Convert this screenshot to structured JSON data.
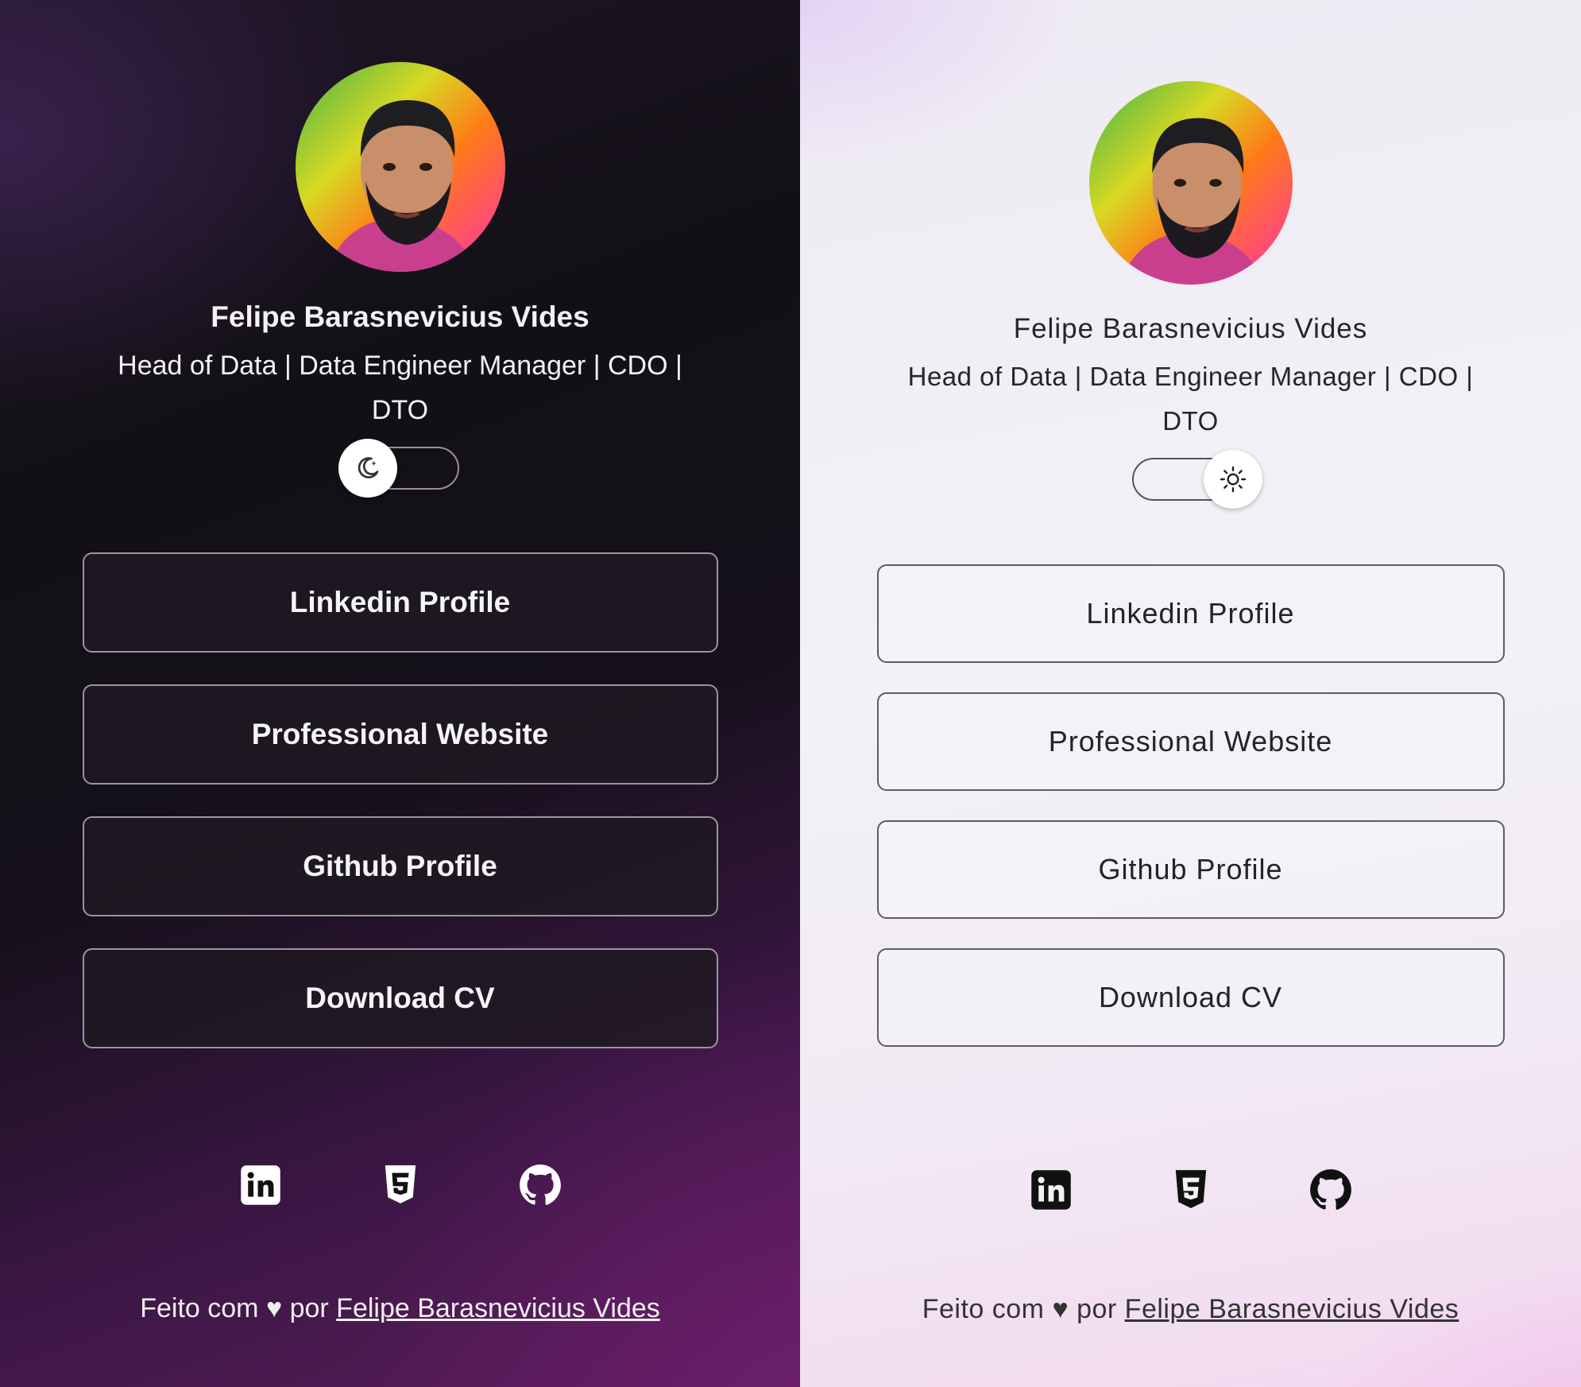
{
  "profile": {
    "name": "Felipe Barasnevicius Vides",
    "bio_line1": "Head of Data | Data Engineer Manager | CDO |",
    "bio_line2": "DTO",
    "avatar_alt": "avatar"
  },
  "theme_toggle": {
    "dark_icon": "moon-icon",
    "light_icon": "sun-icon"
  },
  "links": [
    {
      "label": "Linkedin Profile"
    },
    {
      "label": "Professional Website"
    },
    {
      "label": "Github Profile"
    },
    {
      "label": "Download CV"
    }
  ],
  "social_icons": [
    "linkedin-icon",
    "html5-icon",
    "github-icon"
  ],
  "footer": {
    "prefix": "Feito com",
    "heart": "♥",
    "by": "por",
    "author_link": "Felipe Barasnevicius Vides"
  },
  "colors": {
    "dark_bg": "#121015",
    "dark_accent": "#5a1d5a",
    "light_bg": "#f3f1f6",
    "light_accent": "#f3d8ef"
  }
}
